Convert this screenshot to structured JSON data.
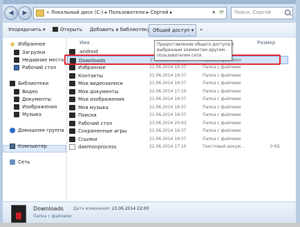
{
  "window": {
    "breadcrumb": [
      "«",
      "Локальный диск (C:)",
      "Пользователи",
      "Сергей"
    ],
    "search_placeholder": "Поиск: Сергей"
  },
  "toolbar": {
    "organize": "Упорядочить ▾",
    "open": "Открыть",
    "add_to_library": "Добавить в библиотеку ▾",
    "share": "Общий доступ ▾",
    "more": "»"
  },
  "nav": {
    "favorites": "Избранное",
    "downloads": "Загрузки",
    "recent": "Недавние места",
    "desktop": "Рабочий стол",
    "libraries": "Библиотеки",
    "video": "Видео",
    "documents": "Документы",
    "images": "Изображения",
    "music": "Музыка",
    "homegroup": "Домашняя группа",
    "computer": "Компьютер",
    "network": "Сеть"
  },
  "columns": {
    "name": "Имя",
    "size": "Размер"
  },
  "tooltip": {
    "line1": "Предоставление общего доступа к",
    "line2": "выбранным элементам другим",
    "line3": "пользователям сети."
  },
  "files": [
    {
      "name": ".android",
      "date": "",
      "type": "",
      "size": "",
      "icon": "folder"
    },
    {
      "name": "Downloads",
      "date": "23.06.2014 22:00",
      "type": "Папка с файлами",
      "size": "",
      "icon": "folder"
    },
    {
      "name": "Избранное",
      "date": "21.06.2014 19:37",
      "type": "Папка с файлами",
      "size": "",
      "icon": "folder"
    },
    {
      "name": "Контакты",
      "date": "21.06.2014 19:37",
      "type": "Папка с файлами",
      "size": "",
      "icon": "folder"
    },
    {
      "name": "Мои видеозаписи",
      "date": "21.06.2014 19:37",
      "type": "Папка с файлами",
      "size": "",
      "icon": "folder"
    },
    {
      "name": "Мои документы",
      "date": "22.06.2014 17:10",
      "type": "Папка с файлами",
      "size": "",
      "icon": "folder"
    },
    {
      "name": "Мои изображения",
      "date": "21.06.2014 19:37",
      "type": "Папка с файлами",
      "size": "",
      "icon": "folder"
    },
    {
      "name": "Моя музыка",
      "date": "21.06.2014 19:37",
      "type": "Папка с файлами",
      "size": "",
      "icon": "folder"
    },
    {
      "name": "Поиски",
      "date": "21.06.2014 19:37",
      "type": "Папка с файлами",
      "size": "",
      "icon": "folder"
    },
    {
      "name": "Рабочий стол",
      "date": "23.06.2014 20:43",
      "type": "Папка с файлами",
      "size": "",
      "icon": "folder"
    },
    {
      "name": "Сохраненные игры",
      "date": "21.06.2014 19:37",
      "type": "Папка с файлами",
      "size": "",
      "icon": "folder"
    },
    {
      "name": "Ссылки",
      "date": "21.06.2014 19:37",
      "type": "Папка с файлами",
      "size": "",
      "icon": "folder"
    },
    {
      "name": "daemonprocess",
      "date": "22.06.2014 17:10",
      "type": "Текстовый докум...",
      "size": "0 КБ",
      "icon": "file"
    }
  ],
  "details": {
    "name": "Downloads",
    "type": "Папка с файлами",
    "date_label": "Дата изменения:",
    "date_value": "23.06.2014 22:00"
  }
}
